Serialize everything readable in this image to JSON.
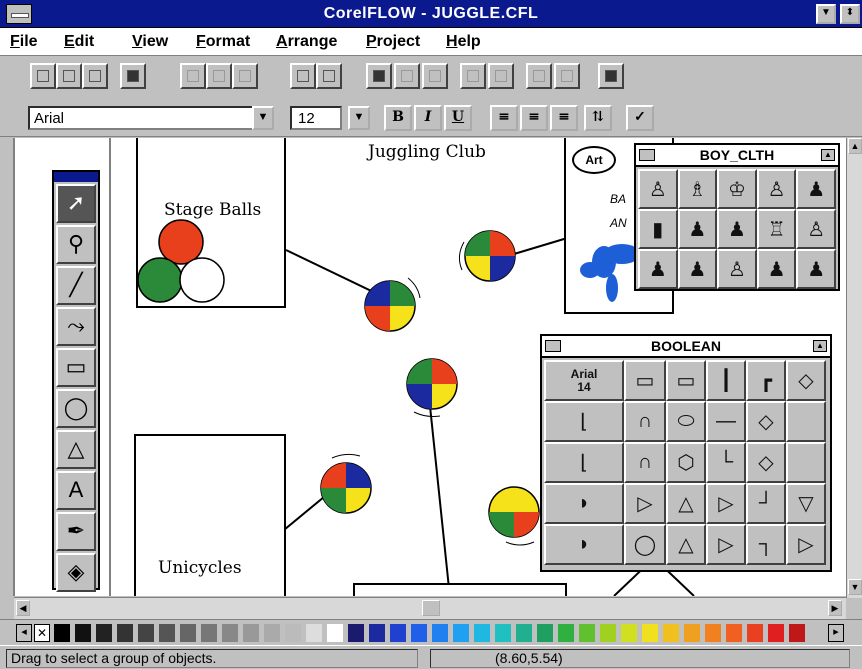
{
  "window": {
    "title": "CorelFLOW - JUGGLE.CFL"
  },
  "menu": [
    "File",
    "Edit",
    "View",
    "Format",
    "Arrange",
    "Project",
    "Help"
  ],
  "format_bar": {
    "font": "Arial",
    "size": "12",
    "bold": "B",
    "italic": "I",
    "underline": "U"
  },
  "canvas": {
    "title": "Juggling Club",
    "stage_balls": "Stage Balls",
    "unicycles": "Unicycles",
    "oval_label": "Art",
    "partial_text_1": "BA",
    "partial_text_2": "AN"
  },
  "palettes": {
    "boy_cloth": {
      "title": "BOY_CLTH",
      "items": 15
    },
    "boolean": {
      "title": "BOOLEAN",
      "font_cell": "Arial",
      "font_size_cell": "14"
    }
  },
  "colors": {
    "title_bar": "#0a1a8e",
    "ball_red": "#e8401c",
    "ball_green": "#2a8a3a",
    "ball_yellow": "#f5e21a",
    "ball_blue": "#1c2aa0",
    "balloon": "#1e5fd8"
  },
  "status": {
    "message": "Drag to select a group of objects.",
    "coords": "(8.60,5.54)"
  }
}
